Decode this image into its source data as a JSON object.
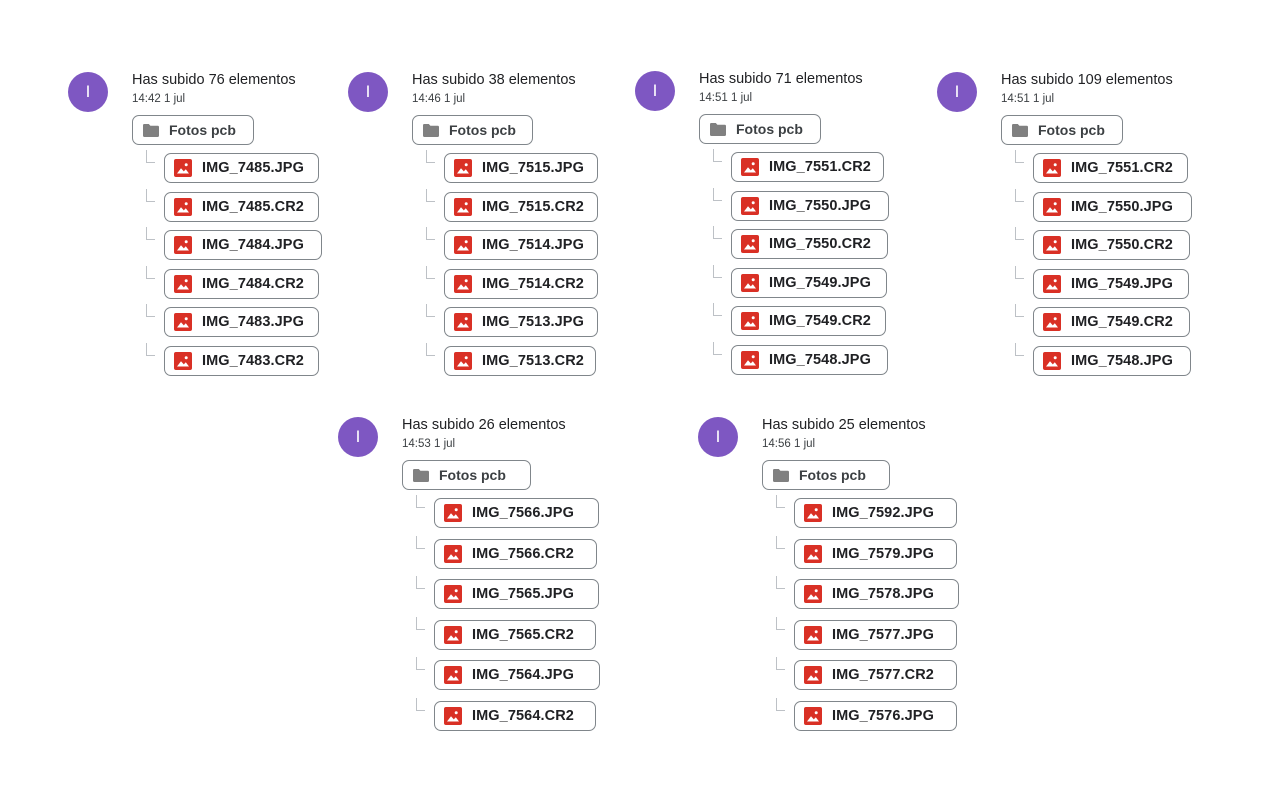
{
  "avatar_color": "#7e57c2",
  "file_icon_color": "#d93025",
  "folder_icon_color": "#808080",
  "icons": {
    "avatar_letter": "I",
    "folder": "folder-icon",
    "file": "image-icon"
  },
  "activities": [
    {
      "avatar": "I",
      "title": "Has subido 76 elementos",
      "time": "14:42 1 jul",
      "folder": "Fotos pcb",
      "files": [
        "IMG_7485.JPG",
        "IMG_7485.CR2",
        "IMG_7484.JPG",
        "IMG_7484.CR2",
        "IMG_7483.JPG",
        "IMG_7483.CR2"
      ]
    },
    {
      "avatar": "I",
      "title": "Has subido 38 elementos",
      "time": "14:46 1 jul",
      "folder": "Fotos pcb",
      "files": [
        "IMG_7515.JPG",
        "IMG_7515.CR2",
        "IMG_7514.JPG",
        "IMG_7514.CR2",
        "IMG_7513.JPG",
        "IMG_7513.CR2"
      ]
    },
    {
      "avatar": "I",
      "title": "Has subido 71 elementos",
      "time": "14:51 1 jul",
      "folder": "Fotos pcb",
      "files": [
        "IMG_7551.CR2",
        "IMG_7550.JPG",
        "IMG_7550.CR2",
        "IMG_7549.JPG",
        "IMG_7549.CR2",
        "IMG_7548.JPG"
      ]
    },
    {
      "avatar": "I",
      "title": "Has subido 109 elementos",
      "time": "14:51 1 jul",
      "folder": "Fotos pcb",
      "files": [
        "IMG_7551.CR2",
        "IMG_7550.JPG",
        "IMG_7550.CR2",
        "IMG_7549.JPG",
        "IMG_7549.CR2",
        "IMG_7548.JPG"
      ]
    },
    {
      "avatar": "I",
      "title": "Has subido 26 elementos",
      "time": "14:53 1 jul",
      "folder": "Fotos pcb",
      "files": [
        "IMG_7566.JPG",
        "IMG_7566.CR2",
        "IMG_7565.JPG",
        "IMG_7565.CR2",
        "IMG_7564.JPG",
        "IMG_7564.CR2"
      ]
    },
    {
      "avatar": "I",
      "title": "Has subido 25 elementos",
      "time": "14:56 1 jul",
      "folder": "Fotos pcb",
      "files": [
        "IMG_7592.JPG",
        "IMG_7579.JPG",
        "IMG_7578.JPG",
        "IMG_7577.JPG",
        "IMG_7577.CR2",
        "IMG_7576.JPG"
      ]
    }
  ]
}
